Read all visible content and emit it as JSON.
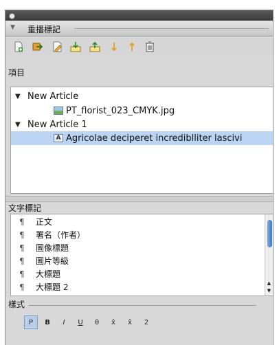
{
  "panel": {
    "title": "重播標記"
  },
  "toolbar": {
    "buttons": [
      {
        "name": "new-article-button",
        "icon": "new-document-icon"
      },
      {
        "name": "map-article-button",
        "icon": "mapping-arrow-icon"
      },
      {
        "name": "edit-tag-button",
        "icon": "pencil-icon"
      },
      {
        "name": "import-button",
        "icon": "import-tray-icon"
      },
      {
        "name": "export-button",
        "icon": "export-tray-icon"
      },
      {
        "name": "move-down-button",
        "icon": "arrow-down-icon"
      },
      {
        "name": "move-up-button",
        "icon": "arrow-up-icon"
      },
      {
        "name": "delete-button",
        "icon": "trash-icon"
      }
    ]
  },
  "items_section": {
    "label": "項目",
    "rows": [
      {
        "text": "New Article",
        "expanded": true
      },
      {
        "text": "PT_florist_023_CMYK.jpg",
        "icon": "image-file-icon"
      },
      {
        "text": "New Article 1",
        "expanded": true
      },
      {
        "text": "Agricolae deciperet incrediblliter lascivi",
        "icon": "text-frame-icon",
        "selected": true
      }
    ]
  },
  "text_tags_section": {
    "label": "文字標記",
    "items": [
      "正文",
      "署名（作者）",
      "圖像標題",
      "圖片等級",
      "大標題",
      "大標題 2"
    ]
  },
  "mode": {
    "label": "樣式"
  },
  "format_buttons": [
    "P",
    "B",
    "I",
    "U",
    "θ",
    "x̂",
    "x̂",
    "2"
  ],
  "colors": {
    "accent": "#3f77c8",
    "selection": "#bcd4f4"
  }
}
